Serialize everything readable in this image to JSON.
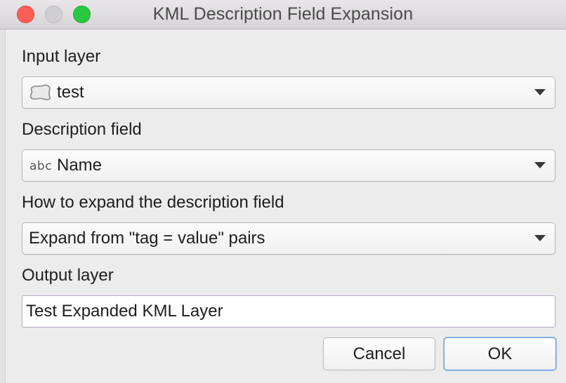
{
  "window": {
    "title": "KML Description Field Expansion"
  },
  "form": {
    "input_layer": {
      "label": "Input layer",
      "value": "test",
      "icon": "polygon-layer-icon"
    },
    "description_field": {
      "label": "Description field",
      "type_prefix": "abc",
      "value": "Name"
    },
    "expand_method": {
      "label": "How to expand the description field",
      "value": "Expand from \"tag = value\" pairs"
    },
    "output_layer": {
      "label": "Output layer",
      "value": "Test Expanded KML Layer"
    }
  },
  "buttons": {
    "cancel": "Cancel",
    "ok": "OK"
  },
  "colors": {
    "close": "#fc5f57",
    "maximize": "#2ac840",
    "ok_focus": "#6c9bd8"
  }
}
